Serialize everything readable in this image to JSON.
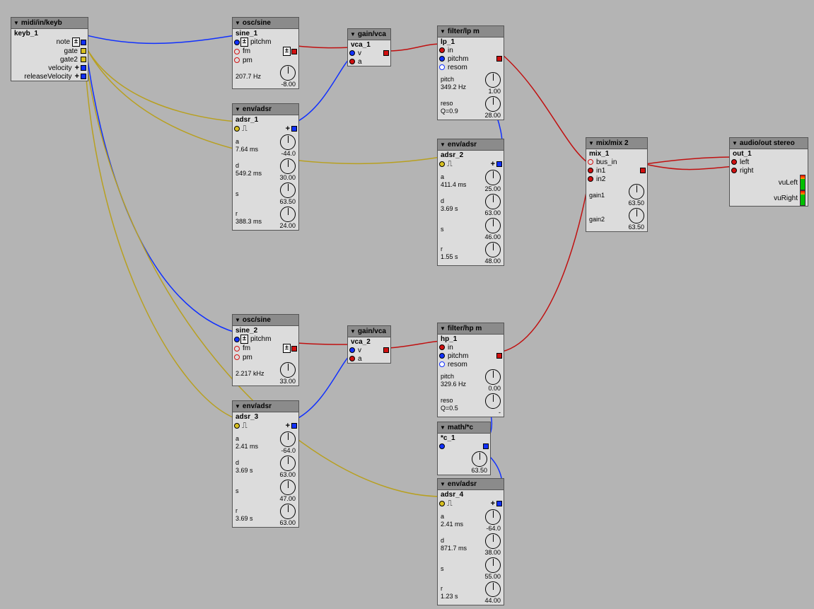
{
  "modules": {
    "keyb": {
      "title": "midi/in/keyb",
      "inst": "keyb_1",
      "outs": [
        "note",
        "gate",
        "gate2",
        "velocity",
        "releaseVelocity"
      ]
    },
    "sine1": {
      "title": "osc/sine",
      "inst": "sine_1",
      "ins": [
        "pitchm",
        "fm",
        "pm"
      ],
      "freq_lbl": "207.7 Hz",
      "freq_val": "-8.00"
    },
    "sine2": {
      "title": "osc/sine",
      "inst": "sine_2",
      "ins": [
        "pitchm",
        "fm",
        "pm"
      ],
      "freq_lbl": "2.217 kHz",
      "freq_val": "33.00"
    },
    "vca1": {
      "title": "gain/vca",
      "inst": "vca_1",
      "ins": [
        "v",
        "a"
      ]
    },
    "vca2": {
      "title": "gain/vca",
      "inst": "vca_2",
      "ins": [
        "v",
        "a"
      ]
    },
    "adsr1": {
      "title": "env/adsr",
      "inst": "adsr_1",
      "a_lbl": "a",
      "a_t": "7.64 ms",
      "a_v": "-44.0",
      "d_lbl": "d",
      "d_t": "549.2 ms",
      "d_v": "30.00",
      "s_lbl": "s",
      "s_v": "63.50",
      "r_lbl": "r",
      "r_t": "388.3 ms",
      "r_v": "24.00"
    },
    "adsr2": {
      "title": "env/adsr",
      "inst": "adsr_2",
      "a_lbl": "a",
      "a_t": "411.4 ms",
      "a_v": "25.00",
      "d_lbl": "d",
      "d_t": "3.69 s",
      "d_v": "63.00",
      "s_lbl": "s",
      "s_v": "46.00",
      "r_lbl": "r",
      "r_t": "1.55 s",
      "r_v": "48.00"
    },
    "adsr3": {
      "title": "env/adsr",
      "inst": "adsr_3",
      "a_lbl": "a",
      "a_t": "2.41 ms",
      "a_v": "-64.0",
      "d_lbl": "d",
      "d_t": "3.69 s",
      "d_v": "63.00",
      "s_lbl": "s",
      "s_v": "47.00",
      "r_lbl": "r",
      "r_t": "3.69 s",
      "r_v": "63.00"
    },
    "adsr4": {
      "title": "env/adsr",
      "inst": "adsr_4",
      "a_lbl": "a",
      "a_t": "2.41 ms",
      "a_v": "-64.0",
      "d_lbl": "d",
      "d_t": "871.7 ms",
      "d_v": "38.00",
      "s_lbl": "s",
      "s_v": "55.00",
      "r_lbl": "r",
      "r_t": "1.23 s",
      "r_v": "44.00"
    },
    "lp": {
      "title": "filter/lp m",
      "inst": "lp_1",
      "ins": [
        "in",
        "pitchm",
        "resom"
      ],
      "pitch_lbl": "pitch",
      "pitch_t": "349.2 Hz",
      "pitch_v": "1.00",
      "reso_lbl": "reso",
      "reso_t": "Q=0.9",
      "reso_v": "28.00"
    },
    "hp": {
      "title": "filter/hp m",
      "inst": "hp_1",
      "ins": [
        "in",
        "pitchm",
        "resom"
      ],
      "pitch_lbl": "pitch",
      "pitch_t": "329.6 Hz",
      "pitch_v": "0.00",
      "reso_lbl": "reso",
      "reso_t": "Q=0.5",
      "reso_v": "-"
    },
    "mathc": {
      "title": "math/*c",
      "inst": "*c_1",
      "val": "63.50"
    },
    "mix": {
      "title": "mix/mix 2",
      "inst": "mix_1",
      "ins": [
        "bus_in",
        "in1",
        "in2"
      ],
      "g1_lbl": "gain1",
      "g1_v": "63.50",
      "g2_lbl": "gain2",
      "g2_v": "63.50"
    },
    "out": {
      "title": "audio/out stereo",
      "inst": "out_1",
      "ins": [
        "left",
        "right"
      ],
      "vuL": "vuLeft",
      "vuR": "vuRight"
    }
  }
}
